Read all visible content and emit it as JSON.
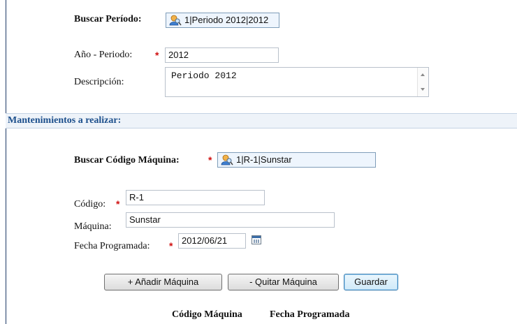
{
  "periodo": {
    "search_label": "Buscar Período:",
    "search_value": "1|Periodo 2012|2012",
    "anio_label": "Año - Periodo:",
    "anio_value": "2012",
    "descripcion_label": "Descripción:",
    "descripcion_value": "Periodo 2012"
  },
  "section": {
    "title": "Mantenimientos a realizar:"
  },
  "maquina": {
    "search_label": "Buscar Código Máquina:",
    "search_value": "1|R-1|Sunstar",
    "codigo_label": "Código:",
    "codigo_value": "R-1",
    "maquina_label": "Máquina:",
    "maquina_value": "Sunstar",
    "fecha_label": "Fecha Programada:",
    "fecha_value": "2012/06/21"
  },
  "required_mark": "*",
  "buttons": {
    "add": "+ Añadir Máquina",
    "remove": "- Quitar Máquina",
    "save": "Guardar"
  },
  "table": {
    "headers": [
      "Código Máquina",
      "Fecha Programada"
    ]
  },
  "icons": {
    "lookup": "search-user-icon",
    "calendar": "calendar-icon"
  }
}
